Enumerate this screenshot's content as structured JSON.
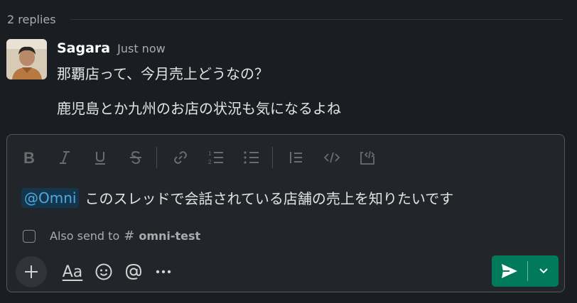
{
  "thread": {
    "replies_label": "2 replies"
  },
  "message": {
    "author": "Sagara",
    "timestamp": "Just now",
    "lines": [
      "那覇店って、今月売上どうなの？",
      "鹿児島とか九州のお店の状況も気になるよね"
    ]
  },
  "composer": {
    "toolbar": [
      {
        "name": "bold-icon"
      },
      {
        "name": "italic-icon"
      },
      {
        "name": "underline-icon"
      },
      {
        "name": "strikethrough-icon"
      },
      {
        "name": "link-icon"
      },
      {
        "name": "ordered-list-icon"
      },
      {
        "name": "bulleted-list-icon"
      },
      {
        "name": "blockquote-icon"
      },
      {
        "name": "code-icon"
      },
      {
        "name": "code-block-icon"
      }
    ],
    "mention": "@Omni",
    "text": "このスレッドで会話されている店舗の売上を知りたいです",
    "also_send_label": "Also send to",
    "also_send_hash": "#",
    "channel": "omni-test",
    "format_label": "Aa",
    "colors": {
      "send": "#007a5a",
      "mention_bg": "#14364d",
      "mention_fg": "#4fa8e0"
    }
  }
}
